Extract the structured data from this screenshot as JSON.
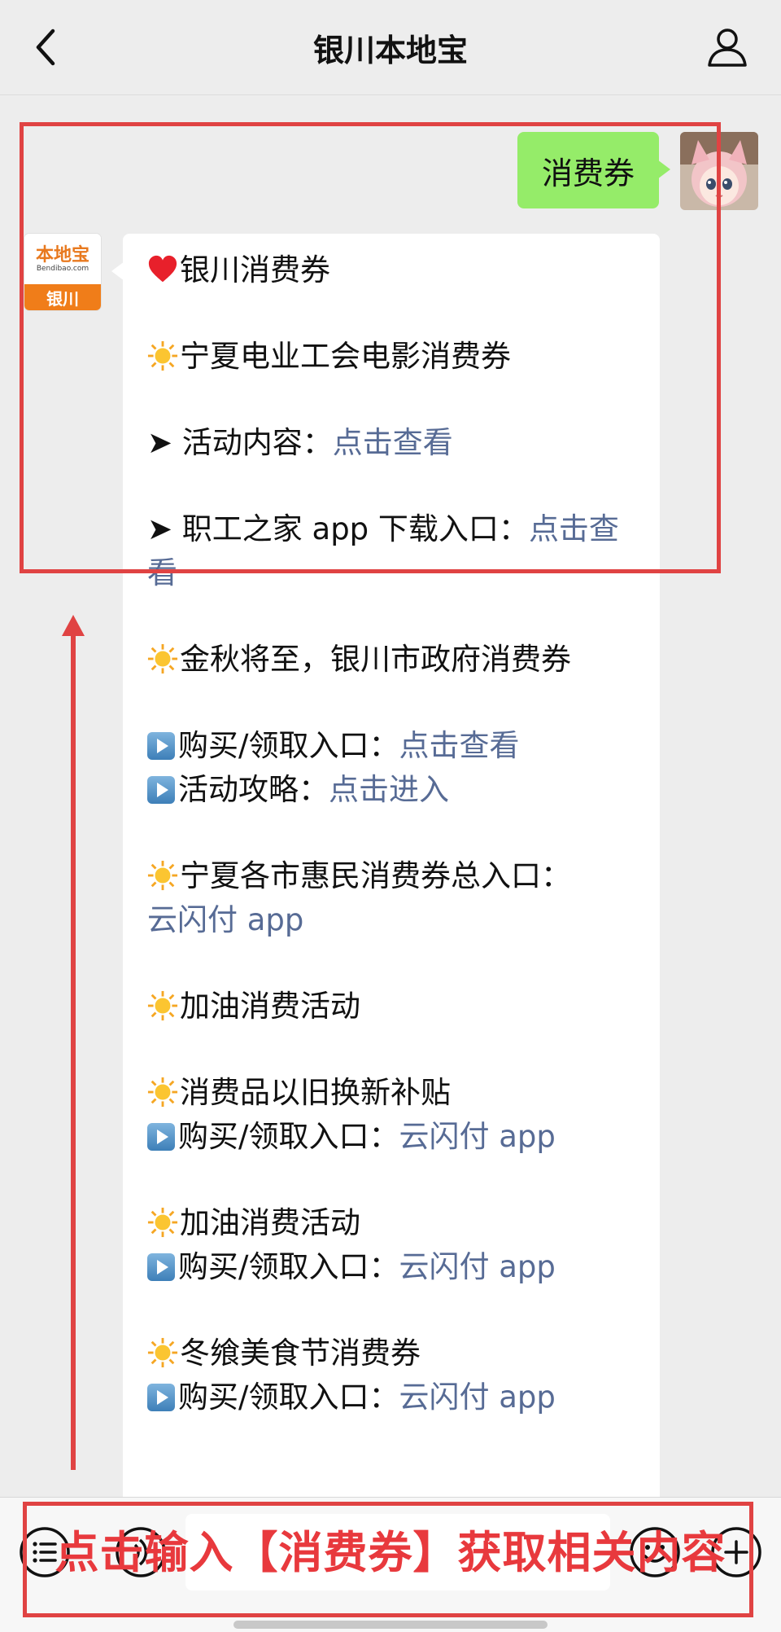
{
  "header": {
    "title": "银川本地宝",
    "back_icon": "chevron-left-icon",
    "profile_icon": "person-icon"
  },
  "user_message": {
    "text": "消费券"
  },
  "bot": {
    "avatar": {
      "logo_text": "本地宝",
      "logo_sub": "Bendibao.com",
      "city": "银川"
    },
    "lines": [
      {
        "emoji": "heart",
        "text": "银川消费券"
      },
      {
        "emoji": "sun",
        "text": "宁夏电业工会电影消费券"
      },
      {
        "prefix": "➤ ",
        "text": "活动内容：",
        "link": "点击查看"
      },
      {
        "prefix": "➤ ",
        "text": "职工之家 app 下载入口：",
        "link": "点击查看"
      },
      {
        "emoji": "sun",
        "text": "金秋将至，银川市政府消费券"
      },
      {
        "emoji": "play",
        "text": "购买/领取入口：",
        "link": "点击查看"
      },
      {
        "emoji": "play",
        "text": "活动攻略：",
        "link": "点击进入"
      },
      {
        "emoji": "sun",
        "text": "宁夏各市惠民消费券总入口：",
        "link": "云闪付 app"
      },
      {
        "emoji": "sun",
        "text": "加油消费活动"
      },
      {
        "emoji": "sun",
        "text": "消费品以旧换新补贴"
      },
      {
        "emoji": "play",
        "text": "购买/领取入口：",
        "link": "云闪付 app"
      },
      {
        "emoji": "sun",
        "text": "加油消费活动"
      },
      {
        "emoji": "play",
        "text": "购买/领取入口：",
        "link": "云闪付 app"
      },
      {
        "emoji": "sun",
        "text": "冬飨美食节消费券"
      },
      {
        "emoji": "play",
        "text": "购买/领取入口：",
        "link": "云闪付 app"
      }
    ]
  },
  "annotation": {
    "caption": "点击输入【消费券】获取相关内容",
    "color": "#e04343"
  },
  "input_bar": {
    "left_icons": [
      "menu-list-icon",
      "voice-icon"
    ],
    "right_icons": [
      "emoji-icon",
      "plus-icon"
    ]
  },
  "colors": {
    "link": "#576b95",
    "user_bubble": "#95ec69",
    "background": "#ededed"
  }
}
